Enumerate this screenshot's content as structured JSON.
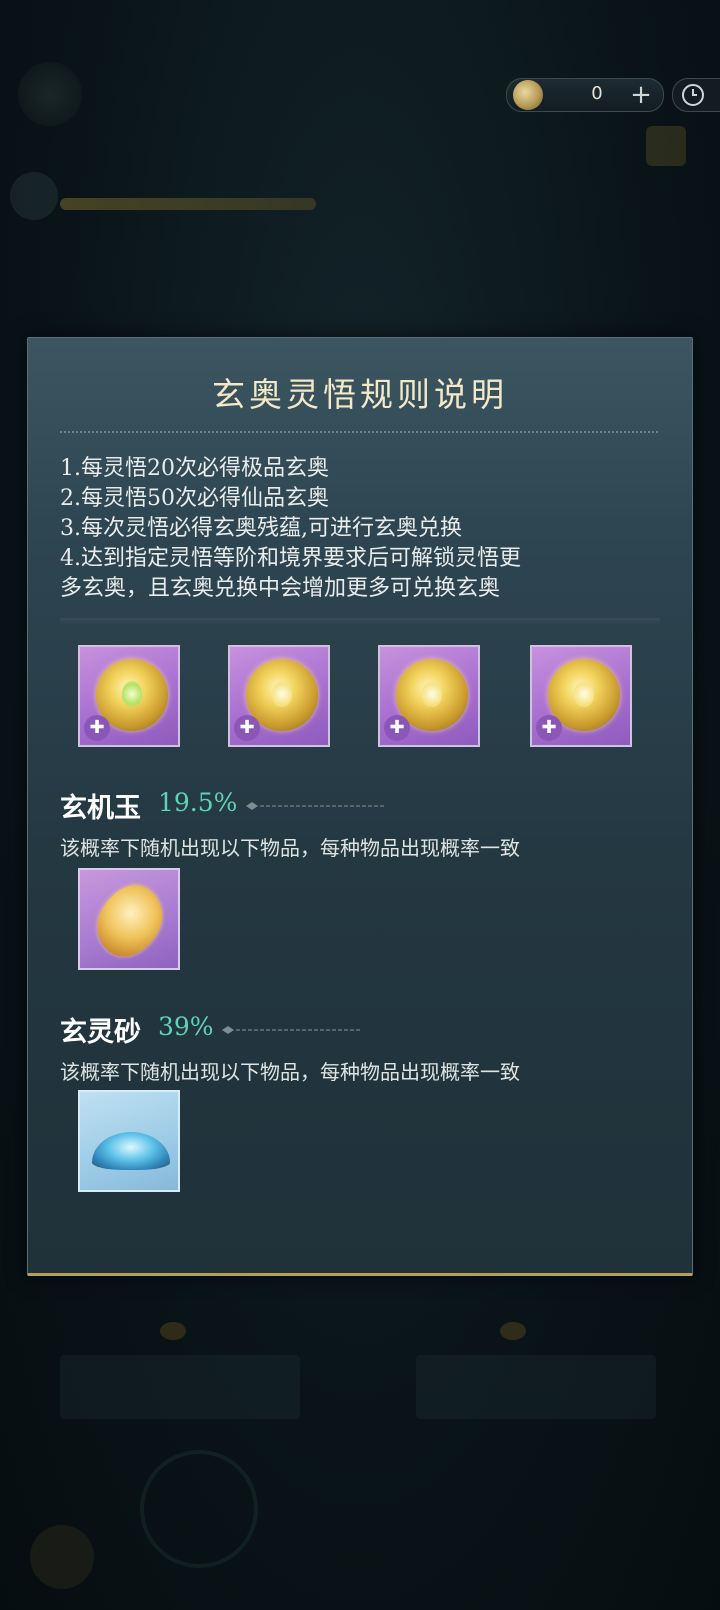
{
  "topbar": {
    "currency_icon": "spirit-coin-icon",
    "currency_value": "0",
    "add_icon": "plus-icon",
    "history_icon": "clock-icon"
  },
  "modal": {
    "title": "玄奥灵悟规则说明",
    "rules": [
      "1.每灵悟20次必得极品玄奥",
      "2.每灵悟50次必得仙品玄奥",
      "3.每次灵悟必得玄奥残蕴,可进行玄奥兑换",
      "4.达到指定灵悟等阶和境界要求后可解锁灵悟更",
      "多玄奥，且玄奥兑换中会增加更多可兑换玄奥"
    ],
    "top_items": [
      {
        "icon": "mystic-orb-icon",
        "badge": "puzzle-icon"
      },
      {
        "icon": "mystic-orb-icon",
        "badge": "puzzle-icon"
      },
      {
        "icon": "mystic-orb-icon",
        "badge": "puzzle-icon"
      },
      {
        "icon": "mystic-orb-icon",
        "badge": "puzzle-icon"
      }
    ],
    "sections": [
      {
        "name": "玄机玉",
        "percent": "19.5%",
        "desc": "该概率下随机出现以下物品，每种物品出现概率一致",
        "item_icon": "jade-stone-icon"
      },
      {
        "name": "玄灵砂",
        "percent": "39%",
        "desc": "该概率下随机出现以下物品，每种物品出现概率一致",
        "item_icon": "spirit-sand-icon"
      }
    ]
  },
  "colors": {
    "accent_teal": "#5fd3b6",
    "title_gold": "#f3e8c8",
    "card_purple": "#a86fd0",
    "card_blue": "#9ccbe6"
  }
}
